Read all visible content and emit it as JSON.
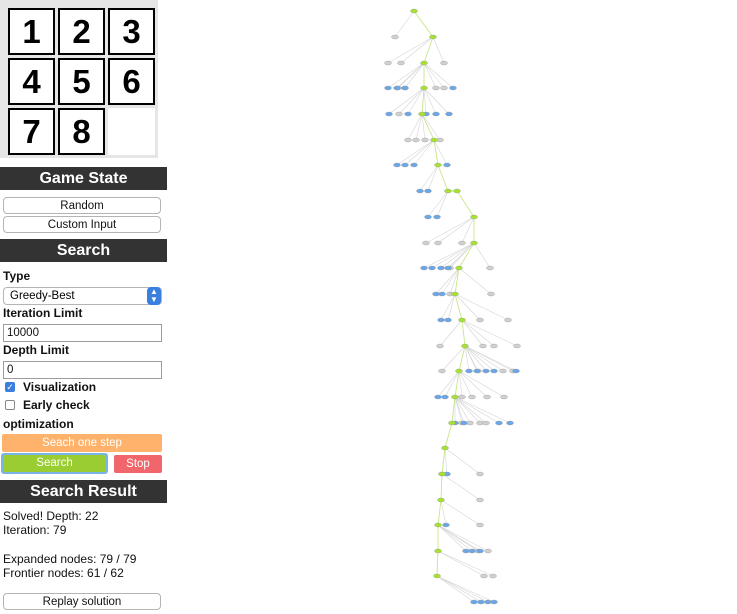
{
  "puzzle": {
    "tiles": [
      "1",
      "2",
      "3",
      "4",
      "5",
      "6",
      "7",
      "8",
      ""
    ]
  },
  "game_state": {
    "header": "Game State",
    "random_label": "Random",
    "custom_input_label": "Custom Input"
  },
  "search": {
    "header": "Search",
    "type_label": "Type",
    "type_value": "Greedy-Best",
    "iteration_limit_label": "Iteration Limit",
    "iteration_limit_value": "10000",
    "depth_limit_label": "Depth Limit",
    "depth_limit_value": "0",
    "visualization_label": "Visualization",
    "visualization_checked": true,
    "early_check_label": "Early check",
    "early_check_checked": false,
    "optimization_label": "optimization",
    "step_button_label": "Seach one step",
    "search_button_label": "Search",
    "stop_button_label": "Stop",
    "colors": {
      "step": "#ffb26b",
      "search": "#9acd32",
      "stop": "#f0666b"
    }
  },
  "result": {
    "header": "Search Result",
    "solved_text": "Solved! Depth: 22",
    "iteration_text": "Iteration: 79",
    "expanded_text": "Expanded nodes: 79 / 79",
    "frontier_text": "Frontier nodes: 61 / 62",
    "replay_label": "Replay solution"
  },
  "tree_colors": {
    "path": "#a6e22e",
    "expanded": "#d0d0d0",
    "frontier": "#6aa6e8",
    "edge": "#d5d5d5",
    "path_edge": "#c6e68a"
  }
}
